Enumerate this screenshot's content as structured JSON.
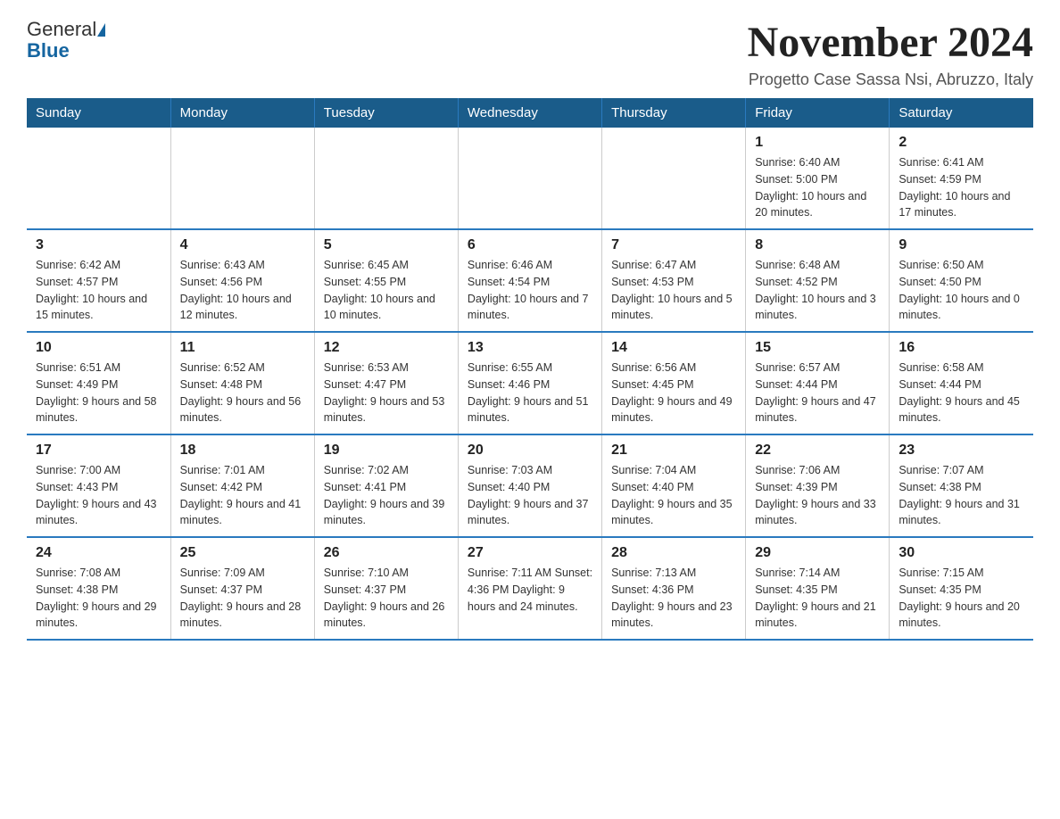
{
  "header": {
    "logo_line1": "General",
    "logo_line2": "Blue",
    "title": "November 2024",
    "subtitle": "Progetto Case Sassa Nsi, Abruzzo, Italy"
  },
  "days_of_week": [
    "Sunday",
    "Monday",
    "Tuesday",
    "Wednesday",
    "Thursday",
    "Friday",
    "Saturday"
  ],
  "weeks": [
    [
      {
        "day": "",
        "info": ""
      },
      {
        "day": "",
        "info": ""
      },
      {
        "day": "",
        "info": ""
      },
      {
        "day": "",
        "info": ""
      },
      {
        "day": "",
        "info": ""
      },
      {
        "day": "1",
        "info": "Sunrise: 6:40 AM\nSunset: 5:00 PM\nDaylight: 10 hours and 20 minutes."
      },
      {
        "day": "2",
        "info": "Sunrise: 6:41 AM\nSunset: 4:59 PM\nDaylight: 10 hours and 17 minutes."
      }
    ],
    [
      {
        "day": "3",
        "info": "Sunrise: 6:42 AM\nSunset: 4:57 PM\nDaylight: 10 hours and 15 minutes."
      },
      {
        "day": "4",
        "info": "Sunrise: 6:43 AM\nSunset: 4:56 PM\nDaylight: 10 hours and 12 minutes."
      },
      {
        "day": "5",
        "info": "Sunrise: 6:45 AM\nSunset: 4:55 PM\nDaylight: 10 hours and 10 minutes."
      },
      {
        "day": "6",
        "info": "Sunrise: 6:46 AM\nSunset: 4:54 PM\nDaylight: 10 hours and 7 minutes."
      },
      {
        "day": "7",
        "info": "Sunrise: 6:47 AM\nSunset: 4:53 PM\nDaylight: 10 hours and 5 minutes."
      },
      {
        "day": "8",
        "info": "Sunrise: 6:48 AM\nSunset: 4:52 PM\nDaylight: 10 hours and 3 minutes."
      },
      {
        "day": "9",
        "info": "Sunrise: 6:50 AM\nSunset: 4:50 PM\nDaylight: 10 hours and 0 minutes."
      }
    ],
    [
      {
        "day": "10",
        "info": "Sunrise: 6:51 AM\nSunset: 4:49 PM\nDaylight: 9 hours and 58 minutes."
      },
      {
        "day": "11",
        "info": "Sunrise: 6:52 AM\nSunset: 4:48 PM\nDaylight: 9 hours and 56 minutes."
      },
      {
        "day": "12",
        "info": "Sunrise: 6:53 AM\nSunset: 4:47 PM\nDaylight: 9 hours and 53 minutes."
      },
      {
        "day": "13",
        "info": "Sunrise: 6:55 AM\nSunset: 4:46 PM\nDaylight: 9 hours and 51 minutes."
      },
      {
        "day": "14",
        "info": "Sunrise: 6:56 AM\nSunset: 4:45 PM\nDaylight: 9 hours and 49 minutes."
      },
      {
        "day": "15",
        "info": "Sunrise: 6:57 AM\nSunset: 4:44 PM\nDaylight: 9 hours and 47 minutes."
      },
      {
        "day": "16",
        "info": "Sunrise: 6:58 AM\nSunset: 4:44 PM\nDaylight: 9 hours and 45 minutes."
      }
    ],
    [
      {
        "day": "17",
        "info": "Sunrise: 7:00 AM\nSunset: 4:43 PM\nDaylight: 9 hours and 43 minutes."
      },
      {
        "day": "18",
        "info": "Sunrise: 7:01 AM\nSunset: 4:42 PM\nDaylight: 9 hours and 41 minutes."
      },
      {
        "day": "19",
        "info": "Sunrise: 7:02 AM\nSunset: 4:41 PM\nDaylight: 9 hours and 39 minutes."
      },
      {
        "day": "20",
        "info": "Sunrise: 7:03 AM\nSunset: 4:40 PM\nDaylight: 9 hours and 37 minutes."
      },
      {
        "day": "21",
        "info": "Sunrise: 7:04 AM\nSunset: 4:40 PM\nDaylight: 9 hours and 35 minutes."
      },
      {
        "day": "22",
        "info": "Sunrise: 7:06 AM\nSunset: 4:39 PM\nDaylight: 9 hours and 33 minutes."
      },
      {
        "day": "23",
        "info": "Sunrise: 7:07 AM\nSunset: 4:38 PM\nDaylight: 9 hours and 31 minutes."
      }
    ],
    [
      {
        "day": "24",
        "info": "Sunrise: 7:08 AM\nSunset: 4:38 PM\nDaylight: 9 hours and 29 minutes."
      },
      {
        "day": "25",
        "info": "Sunrise: 7:09 AM\nSunset: 4:37 PM\nDaylight: 9 hours and 28 minutes."
      },
      {
        "day": "26",
        "info": "Sunrise: 7:10 AM\nSunset: 4:37 PM\nDaylight: 9 hours and 26 minutes."
      },
      {
        "day": "27",
        "info": "Sunrise: 7:11 AM\nSunset: 4:36 PM\nDaylight: 9 hours and 24 minutes."
      },
      {
        "day": "28",
        "info": "Sunrise: 7:13 AM\nSunset: 4:36 PM\nDaylight: 9 hours and 23 minutes."
      },
      {
        "day": "29",
        "info": "Sunrise: 7:14 AM\nSunset: 4:35 PM\nDaylight: 9 hours and 21 minutes."
      },
      {
        "day": "30",
        "info": "Sunrise: 7:15 AM\nSunset: 4:35 PM\nDaylight: 9 hours and 20 minutes."
      }
    ]
  ]
}
